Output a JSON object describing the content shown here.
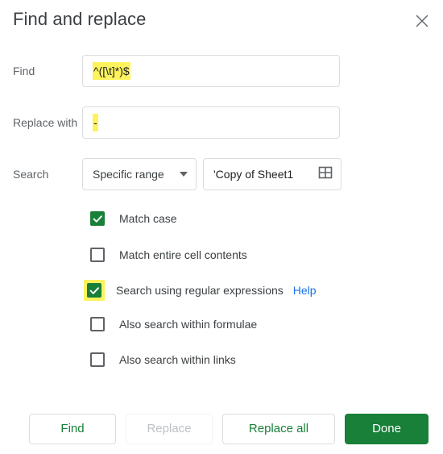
{
  "dialog": {
    "title": "Find and replace",
    "close_icon": "close-icon"
  },
  "fields": {
    "find": {
      "label": "Find",
      "value": "^([\\t]*)$",
      "highlighted": true
    },
    "replace_with": {
      "label": "Replace with",
      "value": "-",
      "highlighted": true
    },
    "search": {
      "label": "Search",
      "scope_value": "Specific range",
      "scope_caret_icon": "chevron-down-icon",
      "range_value": "'Copy of Sheet1",
      "range_picker_icon": "grid-icon"
    }
  },
  "options": [
    {
      "label": "Match case",
      "checked": true,
      "highlighted": false
    },
    {
      "label": "Match entire cell contents",
      "checked": false,
      "highlighted": false
    },
    {
      "label": "Search using regular expressions",
      "checked": true,
      "highlighted": true,
      "help_label": "Help"
    },
    {
      "label": "Also search within formulae",
      "checked": false,
      "highlighted": false
    },
    {
      "label": "Also search within links",
      "checked": false,
      "highlighted": false
    }
  ],
  "buttons": {
    "find": "Find",
    "replace": "Replace",
    "replace_all": "Replace all",
    "done": "Done"
  },
  "colors": {
    "accent_green": "#188038",
    "link_blue": "#1a73e8",
    "highlight_yellow": "#fdf35d",
    "border_grey": "#dadce0",
    "text_primary": "#202124",
    "text_secondary": "#5f6368",
    "disabled_text": "#bdc1c6"
  }
}
